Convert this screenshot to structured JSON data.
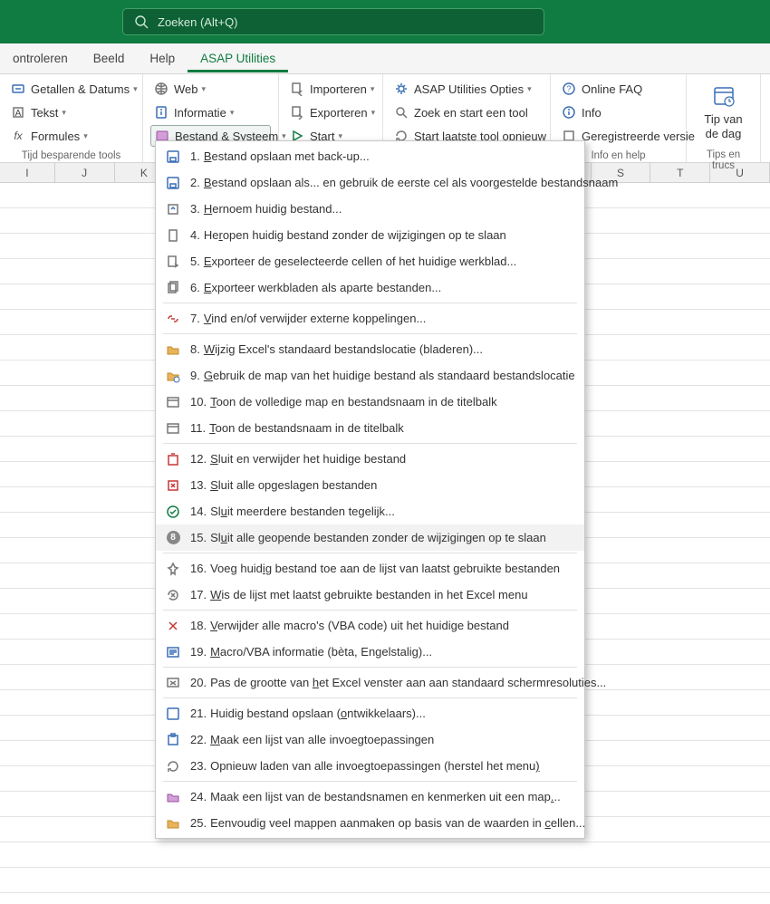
{
  "search": {
    "placeholder": "Zoeken (Alt+Q)"
  },
  "tabs": {
    "controleren": "ontroleren",
    "beeld": "Beeld",
    "help": "Help",
    "asap": "ASAP Utilities"
  },
  "ribbon": {
    "g1": {
      "getallen": "Getallen & Datums",
      "tekst": "Tekst",
      "formules": "Formules",
      "label": "Tijd besparende tools"
    },
    "g2": {
      "web": "Web",
      "informatie": "Informatie",
      "bestand": "Bestand & Systeem"
    },
    "g3": {
      "importeren": "Importeren",
      "exporteren": "Exporteren",
      "start": "Start"
    },
    "g4": {
      "opties": "ASAP Utilities Opties",
      "zoek": "Zoek en start een tool",
      "laatste": "Start laatste tool opnieuw"
    },
    "g5": {
      "faq": "Online FAQ",
      "info": "Info",
      "gereg": "Geregistreerde versie",
      "label": "Info en help"
    },
    "g6": {
      "tip1": "Tip van",
      "tip2": "de dag",
      "label": "Tips en trucs"
    }
  },
  "cols": {
    "i": "I",
    "j": "J",
    "k": "K",
    "s": "S",
    "t": "T",
    "u": "U"
  },
  "menu": {
    "items": [
      {
        "n": "1.",
        "t": "Bestand opslaan met back-up...",
        "u": "B"
      },
      {
        "n": "2.",
        "t": "Bestand opslaan als... en gebruik de eerste cel als voorgestelde bestandsnaam",
        "u": "B"
      },
      {
        "n": "3.",
        "t": "Hernoem huidig bestand...",
        "u": "H"
      },
      {
        "n": "4.",
        "t": "Heropen huidig bestand zonder de wijzigingen op te slaan",
        "u": "r"
      },
      {
        "n": "5.",
        "t": "Exporteer de geselecteerde cellen of het huidige werkblad...",
        "u": "E"
      },
      {
        "n": "6.",
        "t": "Exporteer werkbladen als aparte bestanden...",
        "u": "E"
      },
      {
        "n": "7.",
        "t": "Vind en/of verwijder externe koppelingen...",
        "u": "V"
      },
      {
        "n": "8.",
        "t": "Wijzig Excel's standaard bestandslocatie (bladeren)...",
        "u": "W"
      },
      {
        "n": "9.",
        "t": "Gebruik de map van het huidige bestand als standaard bestandslocatie",
        "u": "G"
      },
      {
        "n": "10.",
        "t": "Toon de volledige map en bestandsnaam in de titelbalk",
        "u": "T"
      },
      {
        "n": "11.",
        "t": "Toon de bestandsnaam in de titelbalk",
        "u": "T"
      },
      {
        "n": "12.",
        "t": "Sluit en verwijder het huidige bestand",
        "u": "S"
      },
      {
        "n": "13.",
        "t": "Sluit alle opgeslagen bestanden",
        "u": "S"
      },
      {
        "n": "14.",
        "t": "Sluit meerdere bestanden tegelijk...",
        "u": "u"
      },
      {
        "n": "15.",
        "t": "Sluit alle geopende bestanden zonder de wijzigingen op te slaan",
        "u": "u"
      },
      {
        "n": "16.",
        "t": "Voeg huidig bestand toe aan de lijst van laatst gebruikte bestanden",
        "u": "i"
      },
      {
        "n": "17.",
        "t": "Wis de lijst met laatst gebruikte bestanden in het Excel menu",
        "u": "W"
      },
      {
        "n": "18.",
        "t": "Verwijder alle macro's (VBA code) uit het huidige bestand",
        "u": "V"
      },
      {
        "n": "19.",
        "t": "Macro/VBA informatie (bèta, Engelstalig)...",
        "u": "M"
      },
      {
        "n": "20.",
        "t": "Pas de grootte van het Excel venster aan aan standaard schermresoluties...",
        "u": "h"
      },
      {
        "n": "21.",
        "t": "Huidig bestand opslaan (ontwikkelaars)...",
        "u": "o"
      },
      {
        "n": "22.",
        "t": "Maak een lijst van alle invoegtoepassingen",
        "u": "M"
      },
      {
        "n": "23.",
        "t": "Opnieuw laden van alle invoegtoepassingen (herstel het menu)",
        "u": ")"
      },
      {
        "n": "24.",
        "t": "Maak een lijst van de bestandsnamen en kenmerken uit een map...",
        "u": "."
      },
      {
        "n": "25.",
        "t": "Eenvoudig veel mappen aanmaken op basis van de waarden in cellen...",
        "u": "c"
      }
    ]
  }
}
